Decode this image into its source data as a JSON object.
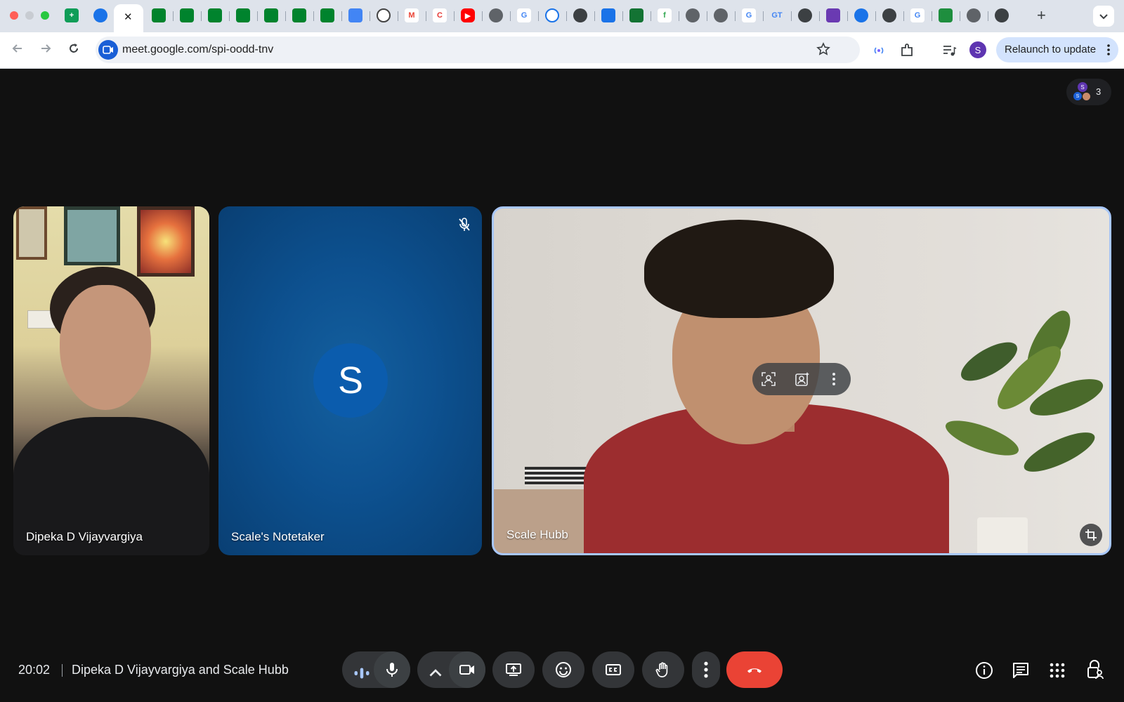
{
  "browser": {
    "url": "meet.google.com/spi-oodd-tnv",
    "relaunch_label": "Relaunch to update",
    "profile_initial": "S",
    "close_tab_glyph": "✕",
    "new_tab_glyph": "+"
  },
  "meet": {
    "participant_count": "3",
    "participants": [
      {
        "name": "Dipeka D Vijayvargiya"
      },
      {
        "name": "Scale's Notetaker",
        "avatar_initial": "S"
      },
      {
        "name": "Scale Hubb"
      }
    ],
    "time": "20:02",
    "meeting_title": "Dipeka D Vijayvargiya and Scale Hubb"
  },
  "colors": {
    "end_call": "#ea4335",
    "notetaker_tile": "#0b4f8c",
    "active_tile_border": "#a8c7fa"
  }
}
